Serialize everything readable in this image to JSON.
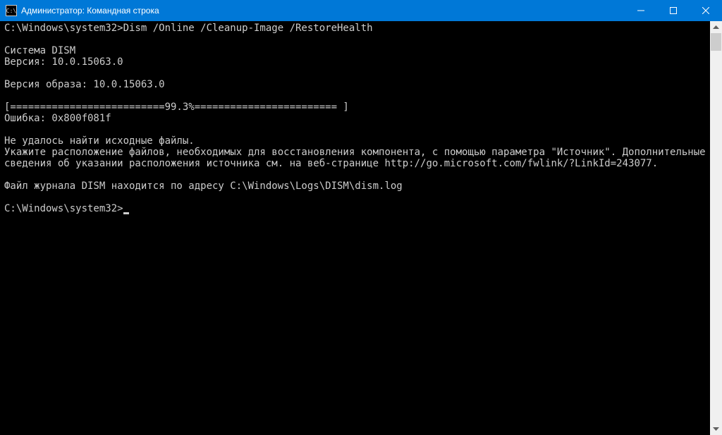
{
  "titlebar": {
    "icon_text": "C:\\",
    "title": "Администратор: Командная строка",
    "minimize": "—",
    "maximize": "▢",
    "close": "✕"
  },
  "terminal": {
    "lines": [
      "C:\\Windows\\system32>Dism /Online /Cleanup-Image /RestoreHealth",
      "",
      "Cистема DISM",
      "Версия: 10.0.15063.0",
      "",
      "Версия образа: 10.0.15063.0",
      "",
      "[==========================99.3%======================== ]",
      "Ошибка: 0x800f081f",
      "",
      "Не удалось найти исходные файлы.",
      "Укажите расположение файлов, необходимых для восстановления компонента, с помощью параметра \"Источник\". Дополнительные сведения об указании расположения источника см. на веб-странице http://go.microsoft.com/fwlink/?LinkId=243077.",
      "",
      "Файл журнала DISM находится по адресу C:\\Windows\\Logs\\DISM\\dism.log",
      "",
      "C:\\Windows\\system32>"
    ]
  }
}
